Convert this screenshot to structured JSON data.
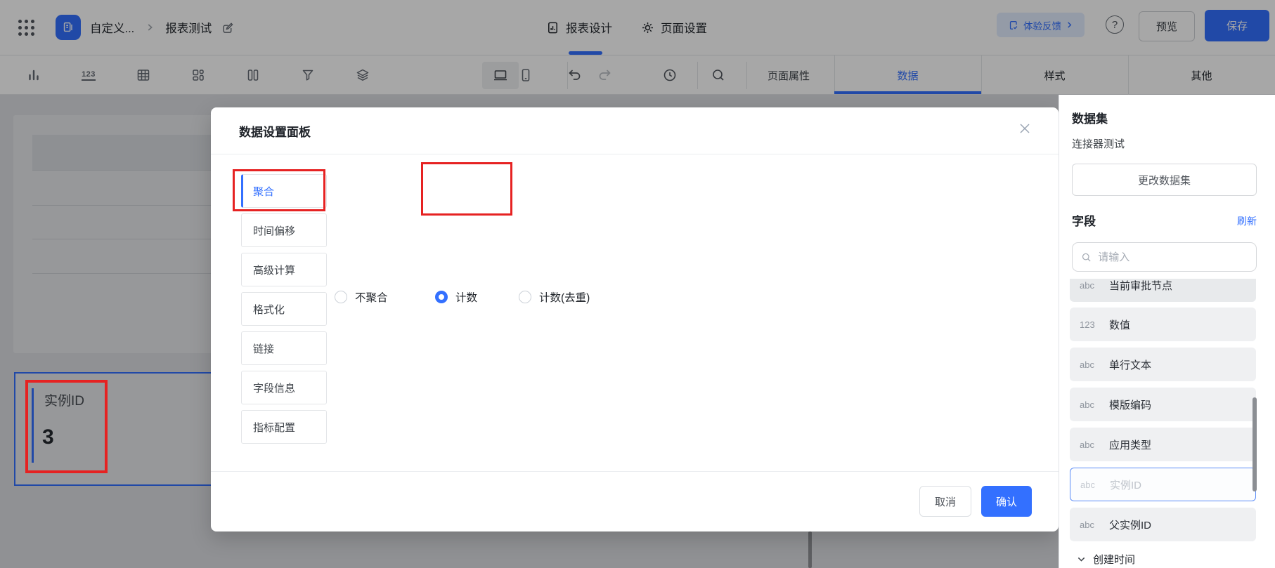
{
  "header": {
    "breadcrumb": {
      "app": "自定义...",
      "page": "报表测试"
    },
    "nav_design": "报表设计",
    "nav_page_settings": "页面设置",
    "feedback": "体验反馈",
    "preview": "预览",
    "save": "保存"
  },
  "toolbar": {
    "page_properties": "页面属性"
  },
  "tabs": {
    "data": "数据",
    "style": "样式",
    "other": "其他"
  },
  "canvas": {
    "metric": {
      "label": "实例ID",
      "value": "3"
    }
  },
  "modal": {
    "title": "数据设置面板",
    "sidebar": [
      {
        "label": "聚合"
      },
      {
        "label": "时间偏移"
      },
      {
        "label": "高级计算"
      },
      {
        "label": "格式化"
      },
      {
        "label": "链接"
      },
      {
        "label": "字段信息"
      },
      {
        "label": "指标配置"
      }
    ],
    "radios": [
      {
        "label": "不聚合",
        "selected": false
      },
      {
        "label": "计数",
        "selected": true
      },
      {
        "label": "计数(去重)",
        "selected": false
      }
    ],
    "cancel": "取消",
    "confirm": "确认"
  },
  "panel": {
    "dataset_heading": "数据集",
    "dataset_name": "连接器测试",
    "change_dataset": "更改数据集",
    "fields_heading": "字段",
    "refresh": "刷新",
    "search_placeholder": "请输入",
    "fields": [
      {
        "type": "abc",
        "name": "当前审批节点"
      },
      {
        "type": "123",
        "name": "数值"
      },
      {
        "type": "abc",
        "name": "单行文本"
      },
      {
        "type": "abc",
        "name": "模版编码"
      },
      {
        "type": "abc",
        "name": "应用类型"
      },
      {
        "type": "abc",
        "name": "实例ID"
      },
      {
        "type": "abc",
        "name": "父实例ID"
      }
    ],
    "group_label": "创建时间"
  },
  "colors": {
    "primary": "#3370ff",
    "annotation": "#e62222"
  }
}
